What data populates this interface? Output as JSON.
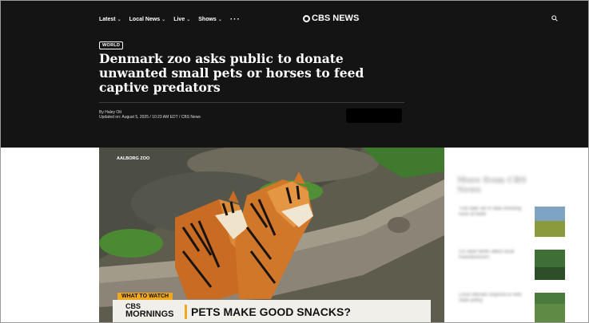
{
  "header": {
    "logo_text": "CBS NEWS",
    "nav": [
      {
        "label": "Latest"
      },
      {
        "label": "Local News"
      },
      {
        "label": "Live"
      },
      {
        "label": "Shows"
      }
    ]
  },
  "article": {
    "category": "WORLD",
    "headline": "Denmark zoo asks public to donate unwanted small pets or horses to feed captive predators",
    "byline": "By Haley Ott",
    "updated": "Updated on: August 5, 2025 / 10:23 AM EDT / CBS News"
  },
  "media": {
    "credit": "AALBORG ZOO",
    "tag": "WHAT TO WATCH",
    "show_line1": "CBS",
    "show_line2": "MORNINGS",
    "tease": "PETS MAKE GOOD SNACKS?"
  },
  "sidebar": {
    "title": "More from CBS News",
    "stories": [
      {
        "title": "Trial date set in fatal shooting case at bank"
      },
      {
        "title": "US steel tariffs affect local manufacturers"
      },
      {
        "title": "Local officials respond to new state policy"
      }
    ]
  },
  "colors": {
    "header_bg": "#141414",
    "accent": "#f0a81c"
  }
}
